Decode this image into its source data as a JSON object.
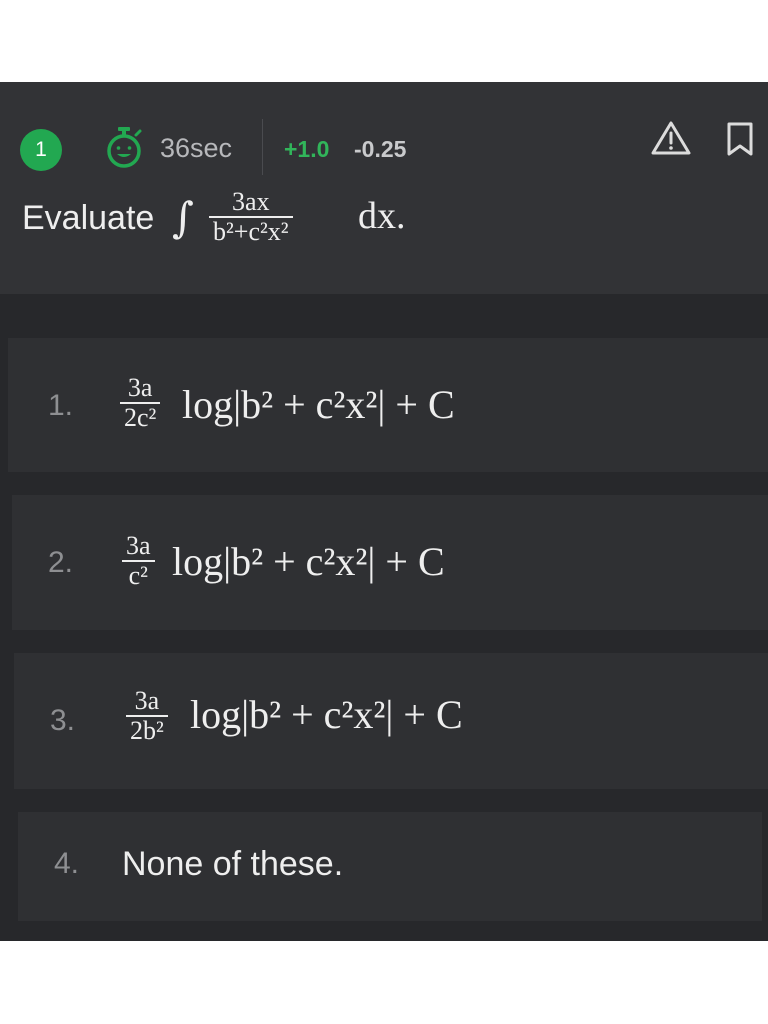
{
  "header": {
    "question_number": "1",
    "timer_text": "36sec",
    "positive_marks": "+1.0",
    "negative_marks": "-0.25",
    "icons": [
      "stopwatch-icon",
      "warning-icon",
      "bookmark-icon"
    ]
  },
  "question": {
    "prefix": "Evaluate",
    "integral_sign": "∫",
    "numerator": "3ax",
    "denominator": "b²+c²x²",
    "suffix": "dx."
  },
  "options": [
    {
      "number": "1.",
      "frac_num": "3a",
      "frac_den": "2c²",
      "expr": "log|b² + c²x²| + C"
    },
    {
      "number": "2.",
      "frac_num": "3a",
      "frac_den": "c²",
      "expr": "log|b² + c²x²| + C"
    },
    {
      "number": "3.",
      "frac_num": "3a",
      "frac_den": "2b²",
      "expr": "log|b² + c²x²| + C"
    },
    {
      "number": "4.",
      "text": "None of these."
    }
  ],
  "colors": {
    "accent_green": "#22a851",
    "positive_green": "#31b55a",
    "header_bg": "#323336",
    "body_bg": "#27282b",
    "option_bg": "#2f3033"
  }
}
